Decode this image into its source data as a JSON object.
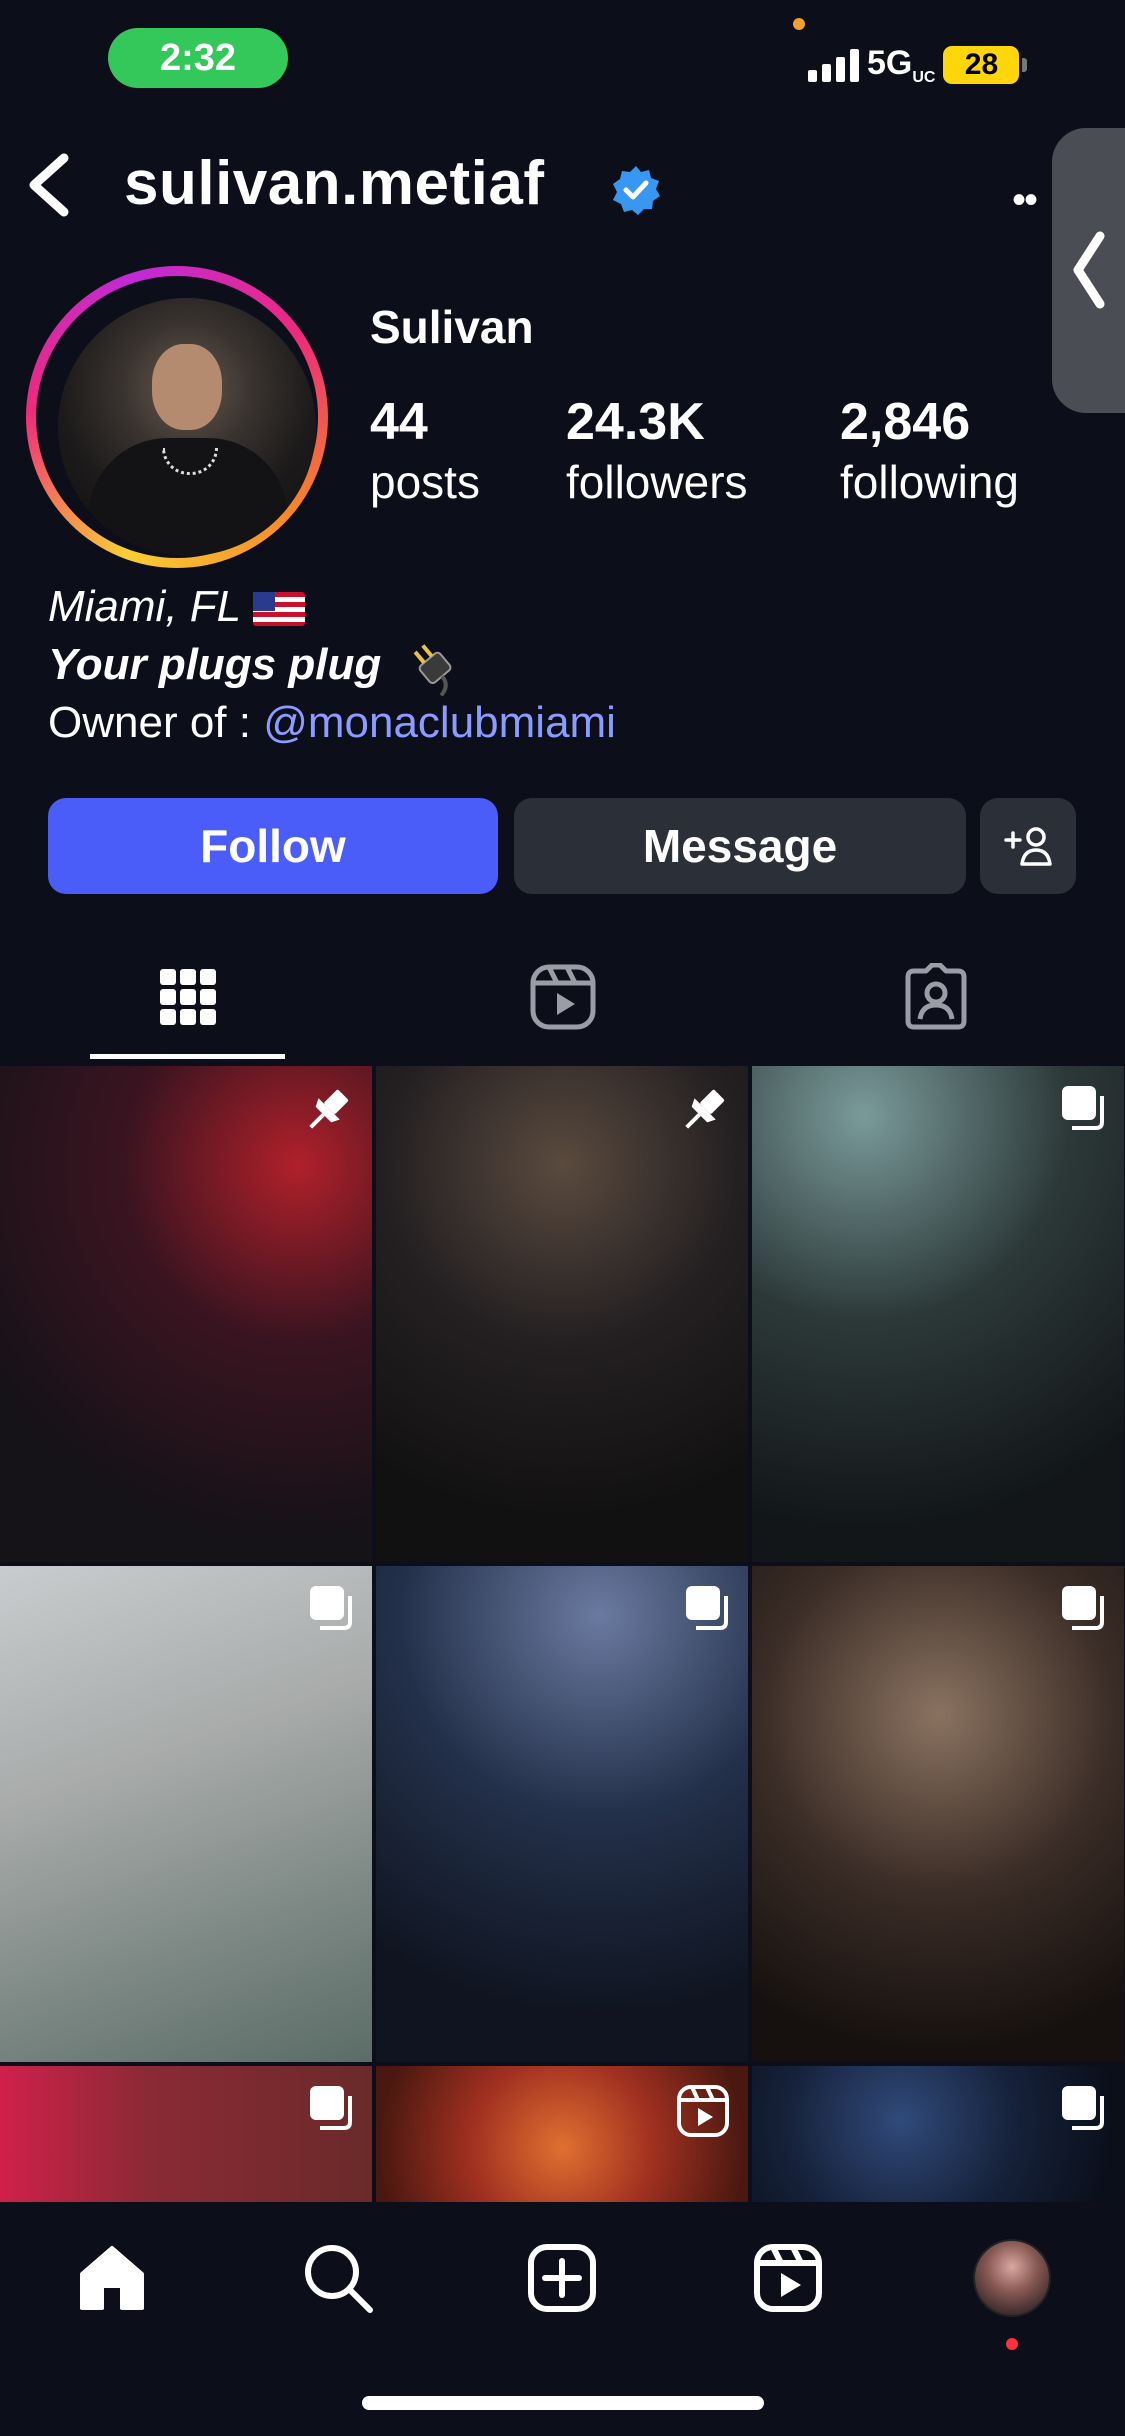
{
  "status_bar": {
    "time": "2:32",
    "network": "5G",
    "network_sub": "UC",
    "battery": "28"
  },
  "header": {
    "username": "sulivan.metiaf",
    "verified_icon": "verified-badge-icon",
    "more_label": "••"
  },
  "profile": {
    "display_name": "Sulivan",
    "stats": [
      {
        "value": "44",
        "label": "posts"
      },
      {
        "value": "24.3K",
        "label": "followers"
      },
      {
        "value": "2,846",
        "label": "following"
      }
    ],
    "bio": {
      "location": "Miami, FL",
      "tagline": "Your plugs plug",
      "owner_prefix": "Owner of : ",
      "owner_mention": "@monaclubmiami"
    }
  },
  "actions": {
    "follow": "Follow",
    "message": "Message"
  },
  "tabs": [
    {
      "name": "grid",
      "icon": "grid-icon",
      "active": true
    },
    {
      "name": "reels",
      "icon": "reels-icon",
      "active": false
    },
    {
      "name": "tagged",
      "icon": "tagged-icon",
      "active": false
    }
  ],
  "posts": [
    {
      "badge": "pin-icon"
    },
    {
      "badge": "pin-icon"
    },
    {
      "badge": "carousel-icon"
    },
    {
      "badge": "carousel-icon"
    },
    {
      "badge": "carousel-icon"
    },
    {
      "badge": "carousel-icon"
    },
    {
      "badge": "carousel-icon"
    },
    {
      "badge": "reel-icon"
    },
    {
      "badge": "carousel-icon"
    }
  ],
  "bottom_nav": [
    "home-icon",
    "search-icon",
    "create-icon",
    "reels-icon",
    "profile-avatar"
  ],
  "colors": {
    "background": "#0c0f1a",
    "follow_button": "#4a5df9",
    "secondary_button": "#2b2f38",
    "mention": "#8c9bff",
    "time_pill": "#34c759",
    "battery": "#ffd60a"
  }
}
